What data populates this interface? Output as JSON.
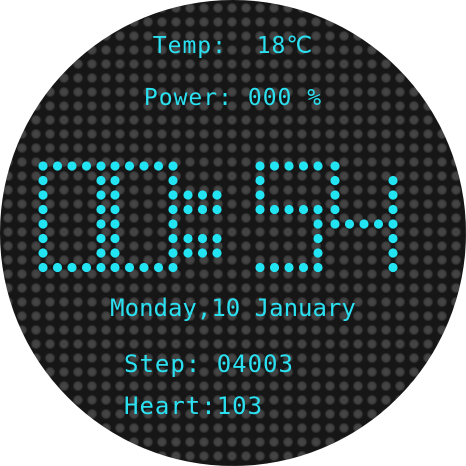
{
  "temperature": {
    "label": "Temp:",
    "value": "18",
    "unit": "℃"
  },
  "power": {
    "label": "Power:",
    "value": "000",
    "unit": "%"
  },
  "time": {
    "hours": "00",
    "minutes": "54"
  },
  "date": {
    "text": "Monday,10 January"
  },
  "steps": {
    "label": "Step:",
    "value": "04003"
  },
  "heart": {
    "label": "Heart:",
    "value": "103"
  },
  "colors": {
    "accent": "#23e4f2",
    "background": "#161616",
    "dot_off": "#404040"
  }
}
